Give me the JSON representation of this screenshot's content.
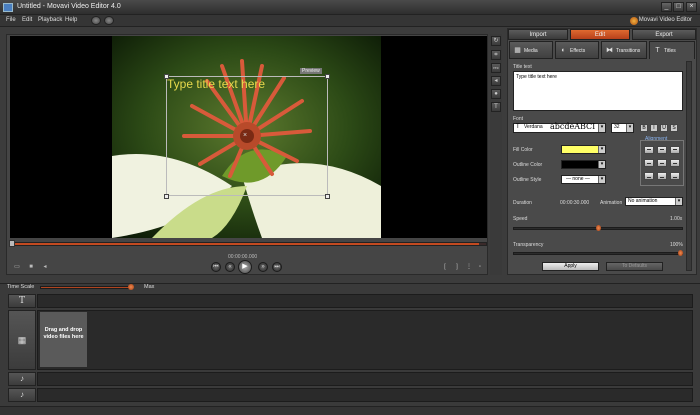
{
  "window": {
    "title": "Untitled - Movavi Video Editor 4.0",
    "brand": "Movavi Video Editor"
  },
  "menu": [
    "File",
    "Edit",
    "Playback",
    "Help"
  ],
  "preview": {
    "tag": "Preview",
    "overlay_title": "Type title text here",
    "time": "00:00:00.000"
  },
  "right_panel": {
    "main_tabs": [
      "Import",
      "Edit",
      "Export"
    ],
    "active_main_tab": "Edit",
    "sub_tabs": [
      {
        "label": "Media",
        "icon": "film-icon"
      },
      {
        "label": "Effects",
        "icon": "effects-icon"
      },
      {
        "label": "Transitions",
        "icon": "transitions-icon"
      },
      {
        "label": "Titles",
        "icon": "titles-icon"
      }
    ],
    "title_text_label": "Title text",
    "title_text_value": "Type title text here",
    "font_label": "Font",
    "font_name": "Verdana",
    "font_preview": "abcdeABCI",
    "font_size": "32",
    "fill_color_label": "Fill Color",
    "fill_color": "#ffff66",
    "outline_color_label": "Outline Color",
    "outline_color": "#000000",
    "outline_style_label": "Outline Style",
    "outline_style_value": "none",
    "alignment_label": "Alignment",
    "duration_label": "Duration",
    "duration_value": "00:00:30.000",
    "animation_label": "Animation",
    "animation_value": "No animation",
    "speed_label": "Speed",
    "speed_value": "1.00x",
    "speed_level": 0.5,
    "transparency_label": "Transparency",
    "transparency_value": "100%",
    "transparency_level": 1.0,
    "apply_label": "Apply",
    "defaults_label": "To Defaults"
  },
  "timeline": {
    "time_scale_label": "Time Scale",
    "time_scale_max": "Max",
    "drop_hint": "Drag and drop video files here"
  },
  "colors": {
    "accent": "#d9531e",
    "title_text": "#e7d94c"
  }
}
